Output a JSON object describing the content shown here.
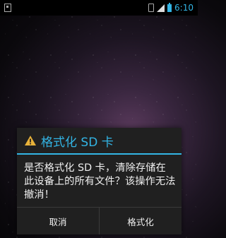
{
  "status_bar": {
    "time": "6:10",
    "icons": [
      "sd-card-icon",
      "vibrate-icon",
      "signal-icon",
      "battery-icon"
    ]
  },
  "dialog": {
    "icon": "warning-icon",
    "title": "格式化 SD 卡",
    "message": "是否格式化 SD 卡，清除存储在此设备上的所有文件？该操作无法撤消！",
    "buttons": {
      "cancel": "取消",
      "confirm": "格式化"
    }
  },
  "colors": {
    "accent": "#33b5e5",
    "dialog_bg": "#202020",
    "text": "#f0f0f0",
    "warning": "#e8b23a"
  }
}
